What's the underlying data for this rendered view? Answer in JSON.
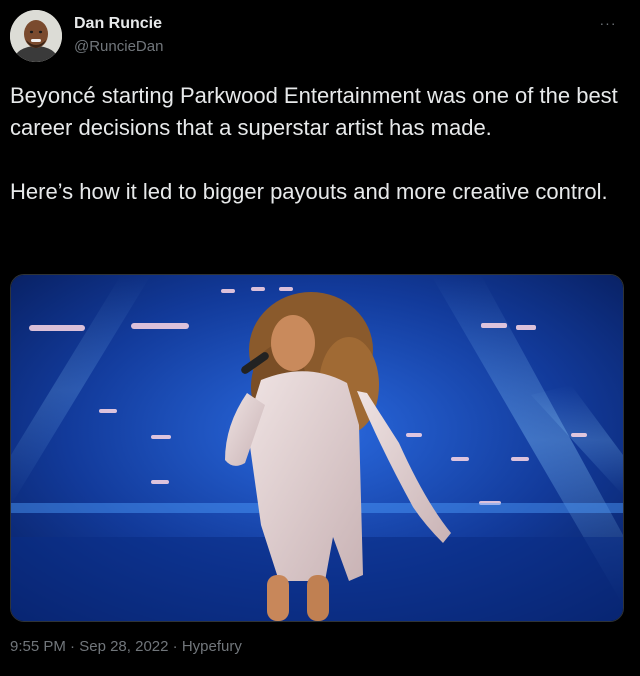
{
  "user": {
    "display_name": "Dan Runcie",
    "handle": "@RuncieDan"
  },
  "more_icon": "more-horizontal-icon",
  "tweet": {
    "paragraph_1": "Beyoncé starting Parkwood Entertainment was one of the best career decisions that a superstar artist has made.",
    "paragraph_2": "Here’s how it led to bigger payouts and more creative control."
  },
  "meta": {
    "time": "9:55 PM",
    "separator": "·",
    "date": "Sep 28, 2022",
    "source": "Hypefury"
  },
  "colors": {
    "background": "#000000",
    "text": "#e7e9ea",
    "muted": "#71767b",
    "stage_blue": "#1b4fc4"
  }
}
